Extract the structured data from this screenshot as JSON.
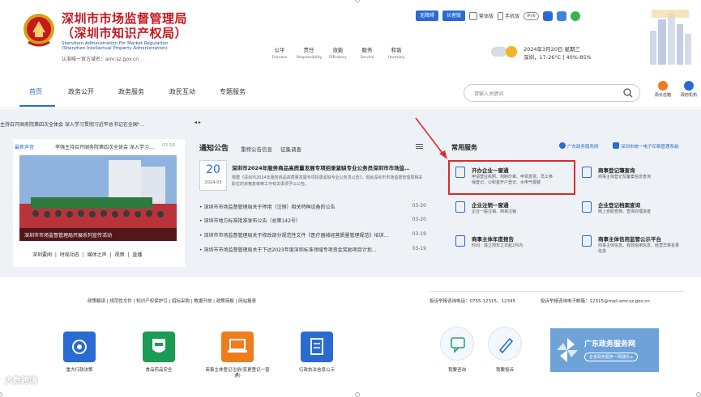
{
  "header": {
    "title_line1": "深圳市市场监督管理局",
    "title_line2": "（深圳市知识产权局）",
    "en_line1": "Shenzhen Administration For Market Regulation",
    "en_line2": "(Shenzhen Intellectual Property Administration)",
    "domain_text": "认准唯一官方域名：amr.sz.gov.cn",
    "values": [
      {
        "cn": "公平",
        "en": "Fairness"
      },
      {
        "cn": "责任",
        "en": "Responsibility"
      },
      {
        "cn": "效能",
        "en": "Efficiency"
      },
      {
        "cn": "服务",
        "en": "Service"
      },
      {
        "cn": "和谐",
        "en": "Harmony"
      }
    ],
    "tools": {
      "accessible_label": "无障碍",
      "elder_label": "长者版",
      "trad_label": "繁体版",
      "mobile_label": "手机版",
      "ipv6_label": "IPv6"
    },
    "weather": {
      "date": "2024年3月20日 星期三",
      "detail": "深圳，17-26°C  |  40%-85%"
    }
  },
  "nav": {
    "items": [
      "首页",
      "政务公开",
      "政务服务",
      "政民互动",
      "专题服务"
    ],
    "search_placeholder": "请输入关键词",
    "right_items": [
      "局长信箱",
      "政府机构"
    ]
  },
  "left": {
    "ticker": "主持召开国务院第四次全体会 深入学习贯彻习近平总书记在全国\"…",
    "arrows": "◂ ▸",
    "latest_label": "最新声音",
    "latest_text": "李强主持召开国务院第四次全体会 深入学习…",
    "latest_date": "03-16",
    "photo_caption": "深圳市市场监督管理局开展系列宣传活动",
    "photo_tabs": "深圳要闻 | 时局动态 | 媒体之声 | 视频 | 直播"
  },
  "notices": {
    "tab_active": "通知公告",
    "tabs": [
      "重特公告信息",
      "征集调查"
    ],
    "headline_day": "20",
    "headline_ym": "2024-03",
    "headline_title": "深圳市2024年服务商品高质量发展专项招录紧缺专业公务员深圳市市场监…",
    "headline_body": "根据《深圳市2024年服务商品高质量发展专项招录紧缺专业公务员公告》，现就深圳市市场监督管理局相关职位的资格复审等工作有关事项予以公告。",
    "rows": [
      {
        "text": "深圳市市场监督管理局关于停用（注销）相关特种设备的公告",
        "date": "03-20"
      },
      {
        "text": "深圳市地方标准批准发布公告（总第142号）",
        "date": "03-20"
      },
      {
        "text": "深圳市市场监督管理局关于修改部分规范性文件《医疗器械经营质量管理规范》培训…",
        "date": "03-19"
      },
      {
        "text": "深圳市市场监督管理局关于下达2023年度深圳标准领域专项资金奖励项目计划…",
        "date": "03-19"
      }
    ]
  },
  "services": {
    "title": "常用服务",
    "gov_link": "广东政务服务网",
    "stamp_link": "深圳市统一电子印章管理系统",
    "items": [
      {
        "name": "开办企业一窗通",
        "desc1": "申请营业执照、刻制印章、申领发票、员工参",
        "desc2": "保登记、公积金开户登记、水电气报装"
      },
      {
        "name": "商事登记簿查询",
        "desc1": "商事主体登记及备案信息查询",
        "desc2": ""
      },
      {
        "name": "企业注销一窗通",
        "desc1": "企业一般注销、简易注销",
        "desc2": ""
      },
      {
        "name": "企业登记档案查询",
        "desc1": "网上自助查档、查询办理进度",
        "desc2": ""
      },
      {
        "name": "商事主体年度报告",
        "desc1": "时间：成立周年之日起2月内",
        "desc2": ""
      },
      {
        "name": "商事主体信用监管公示平台",
        "desc1": "商事主体信息、有效信用信息、经营异常名录",
        "desc2": "信息"
      }
    ]
  },
  "footer": {
    "links": "政策解读 | 规范性文件 | 知识产权保护引 | 招标采购 | 数据开放 | 政策简报 | 网站报表",
    "phone": "投诉举报咨询电话：0755-12315、12345",
    "email": "投诉举报咨询电子邮箱：12315@mail.amr.sz.gov.cn",
    "tiles": [
      {
        "label": "重大行政决策",
        "color": "#2a6bd1"
      },
      {
        "label": "食品药品安全",
        "color": "#1a9c54"
      },
      {
        "label": "商事主体登记注册(变更登记一窗通)",
        "color": "#ef7d1d"
      },
      {
        "label": "行政执法信息公示",
        "color": "#2a6bd1"
      }
    ],
    "circles": [
      "我要咨询",
      "我要投诉"
    ],
    "gov_banner_title": "广东政务服务网",
    "gov_banner_btn": "全省政务服务一网通办 ▸"
  },
  "watermark": "大数跨境"
}
